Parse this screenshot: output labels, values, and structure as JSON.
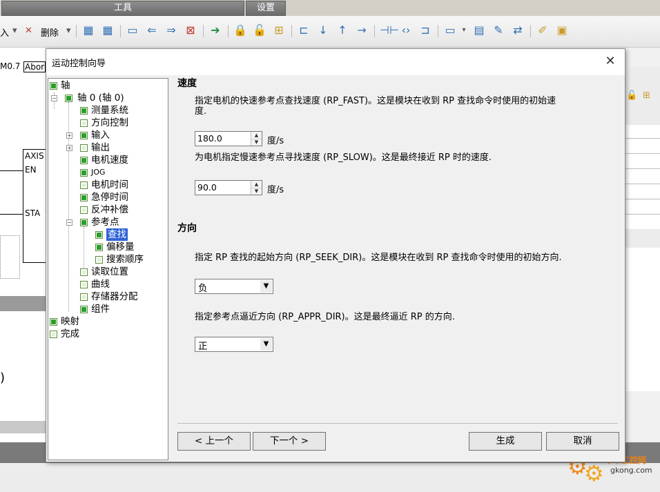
{
  "top_tabs": [
    "工具",
    "设置"
  ],
  "toolbar": {
    "insert_label": "入",
    "delete_label": "删除"
  },
  "bg_editor": {
    "contact_label": "M0.7",
    "abort_label": "Abor",
    "axis_label": "AXIS",
    "en_label": "EN",
    "sta_label": "STA",
    "paren": ")"
  },
  "dialog": {
    "title": "运动控制向导",
    "tree": {
      "axis": "轴",
      "axis0": "轴 0 (轴 0)",
      "measure": "测量系统",
      "direction_ctrl": "方向控制",
      "input": "输入",
      "output": "输出",
      "motor_speed": "电机速度",
      "jog": "JOG",
      "motor_time": "电机时间",
      "estop_time": "急停时间",
      "backlash": "反冲补偿",
      "ref_point": "参考点",
      "find": "查找",
      "offset": "偏移量",
      "search_order": "搜索顺序",
      "read_pos": "读取位置",
      "curve": "曲线",
      "memory": "存储器分配",
      "component": "组件",
      "mapping": "映射",
      "finish": "完成"
    },
    "speed_section": {
      "title": "速度",
      "fast_desc": "指定电机的快速参考点查找速度 (RP_FAST)。这是模块在收到 RP 查找命令时使用的初始速度.",
      "fast_value": "180.0",
      "slow_desc": "为电机指定慢速参考点寻找速度 (RP_SLOW)。这是最终接近 RP 时的速度.",
      "slow_value": "90.0",
      "unit": "度/s"
    },
    "direction_section": {
      "title": "方向",
      "seek_desc": "指定 RP 查找的起始方向 (RP_SEEK_DIR)。这是模块在收到 RP 查找命令时使用的初始方向.",
      "seek_value": "负",
      "appr_desc": "指定参考点逼近方向 (RP_APPR_DIR)。这是最终逼近 RP 的方向.",
      "appr_value": "正"
    },
    "buttons": {
      "prev": "< 上一个",
      "next": "下一个 >",
      "generate": "生成",
      "cancel": "取消"
    }
  },
  "watermark": {
    "line1": "中华工控网",
    "line2": "gkong.com"
  },
  "colors": {
    "check_on": "#2aa02a",
    "selection": "#2f63d6"
  }
}
